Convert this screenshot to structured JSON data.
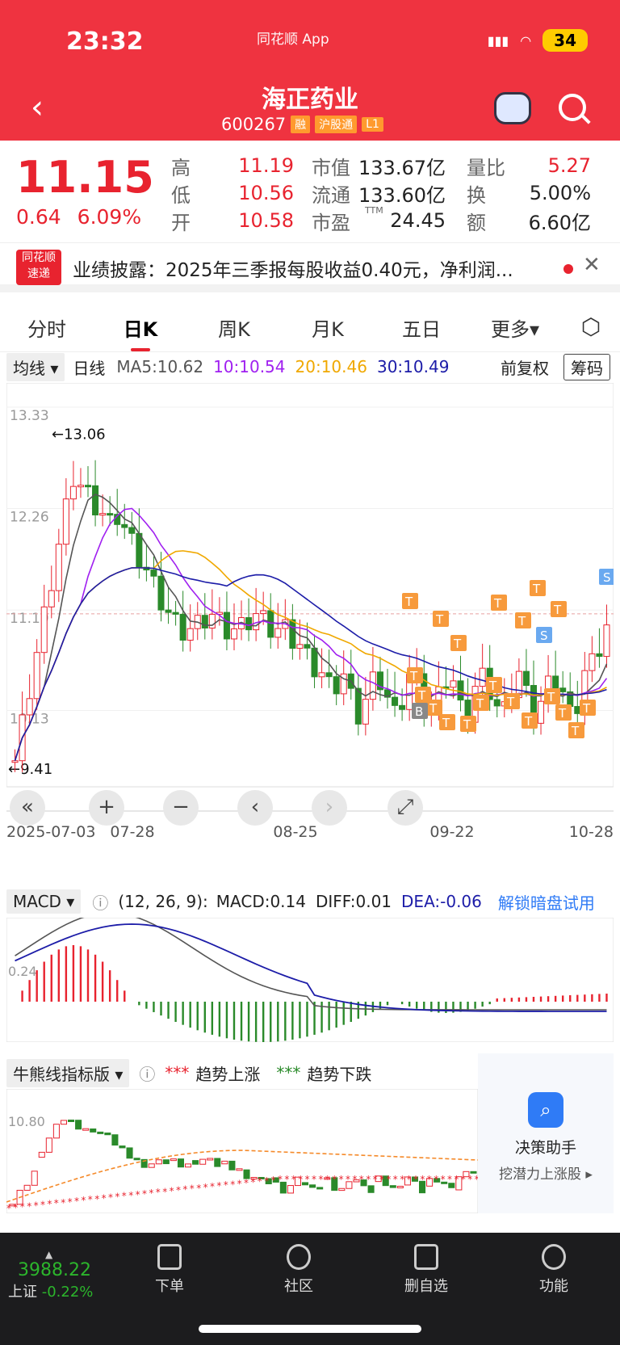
{
  "status": {
    "time": "23:32",
    "app": "同花顺 App",
    "battery": "34"
  },
  "header": {
    "title": "海正药业",
    "code": "600267",
    "tags": [
      "融",
      "沪股通",
      "L1"
    ]
  },
  "quote": {
    "price": "11.15",
    "change": "0.64",
    "change_pct": "6.09%",
    "rows": [
      [
        {
          "k": "高",
          "v": "11.19"
        },
        {
          "k": "市值",
          "v": "133.67亿"
        },
        {
          "k": "量比",
          "v": "5.27"
        }
      ],
      [
        {
          "k": "低",
          "v": "10.56"
        },
        {
          "k": "流通",
          "v": "133.60亿"
        },
        {
          "k": "换",
          "v": "5.00%"
        }
      ],
      [
        {
          "k": "开",
          "v": "10.58"
        },
        {
          "k": "市盈",
          "v": "24.45"
        },
        {
          "k": "额",
          "v": "6.60亿"
        }
      ]
    ],
    "ttm": "TTM"
  },
  "news": {
    "logo_top": "同花顺",
    "logo_bottom": "速递",
    "text": "业绩披露：2025年三季报每股收益0.40元，净利润..."
  },
  "tabs": [
    "分时",
    "日K",
    "周K",
    "月K",
    "五日",
    "更多▾"
  ],
  "ma": {
    "select": "均线 ▾",
    "period": "日线",
    "ma5": "MA5:10.62",
    "ma10": "10:10.54",
    "ma20": "20:10.46",
    "ma30": "30:10.49",
    "fq": "前复权",
    "chouma": "筹码"
  },
  "kline": {
    "y_labels": [
      "13.33",
      "12.26",
      "11.19",
      "10.13",
      "9.41"
    ],
    "high_mark": "←13.06",
    "low_mark": "←9.41",
    "x_labels": [
      "2025-07-03",
      "07-28",
      "08-25",
      "09-22",
      "10-28"
    ],
    "signal_B": "B",
    "signal_S": "S",
    "signal_T": "T"
  },
  "macd": {
    "select": "MACD ▾",
    "params": "(12, 26, 9):",
    "macd": "MACD:0.14",
    "diff": "DIFF:0.01",
    "dea": "DEA:-0.06",
    "unlock": "解锁暗盘试用",
    "y_label": "0.24"
  },
  "bull": {
    "select": "牛熊线指标版 ▾",
    "up": "趋势上涨",
    "down": "趋势下跌",
    "y_label": "10.80"
  },
  "assist": {
    "title": "决策助手",
    "sub": "挖潜力上涨股 ▸"
  },
  "bottom": {
    "index_value": "3988.22",
    "index_name": "上证",
    "index_chg": "-0.22%",
    "nav": [
      "下单",
      "社区",
      "删自选",
      "功能"
    ]
  },
  "colors": {
    "brand": "#ef3340",
    "up": "#e8232f",
    "down": "#2a8a2a",
    "ma5": "#555555",
    "ma10": "#a020f0",
    "ma20": "#f0a800",
    "ma30": "#1c1ca8"
  }
}
